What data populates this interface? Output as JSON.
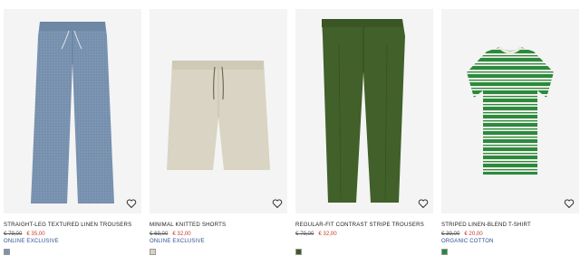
{
  "products": [
    {
      "title": "STRAIGHT-LEG TEXTURED LINEN TROUSERS",
      "old_price": "€ 79,00",
      "new_price": "€ 35,00",
      "tag": "ONLINE EXCLUSIVE",
      "swatch_color": "#7a93b0",
      "icon": "heart-icon"
    },
    {
      "title": "MINIMAL KNITTED SHORTS",
      "old_price": "€ 69,00",
      "new_price": "€ 32,00",
      "tag": "ONLINE EXCLUSIVE",
      "swatch_color": "#d8d2c0",
      "icon": "heart-icon"
    },
    {
      "title": "REGULAR-FIT CONTRAST STRIPE TROUSERS",
      "old_price": "€ 79,00",
      "new_price": "€ 32,00",
      "tag": "",
      "swatch_color": "#3f5a26",
      "icon": "heart-icon"
    },
    {
      "title": "STRIPED LINEN-BLEND T-SHIRT",
      "old_price": "€ 39,00",
      "new_price": "€ 20,00",
      "tag": "ORGANIC COTTON",
      "swatch_color": "#1f8a3a",
      "icon": "heart-icon"
    }
  ]
}
